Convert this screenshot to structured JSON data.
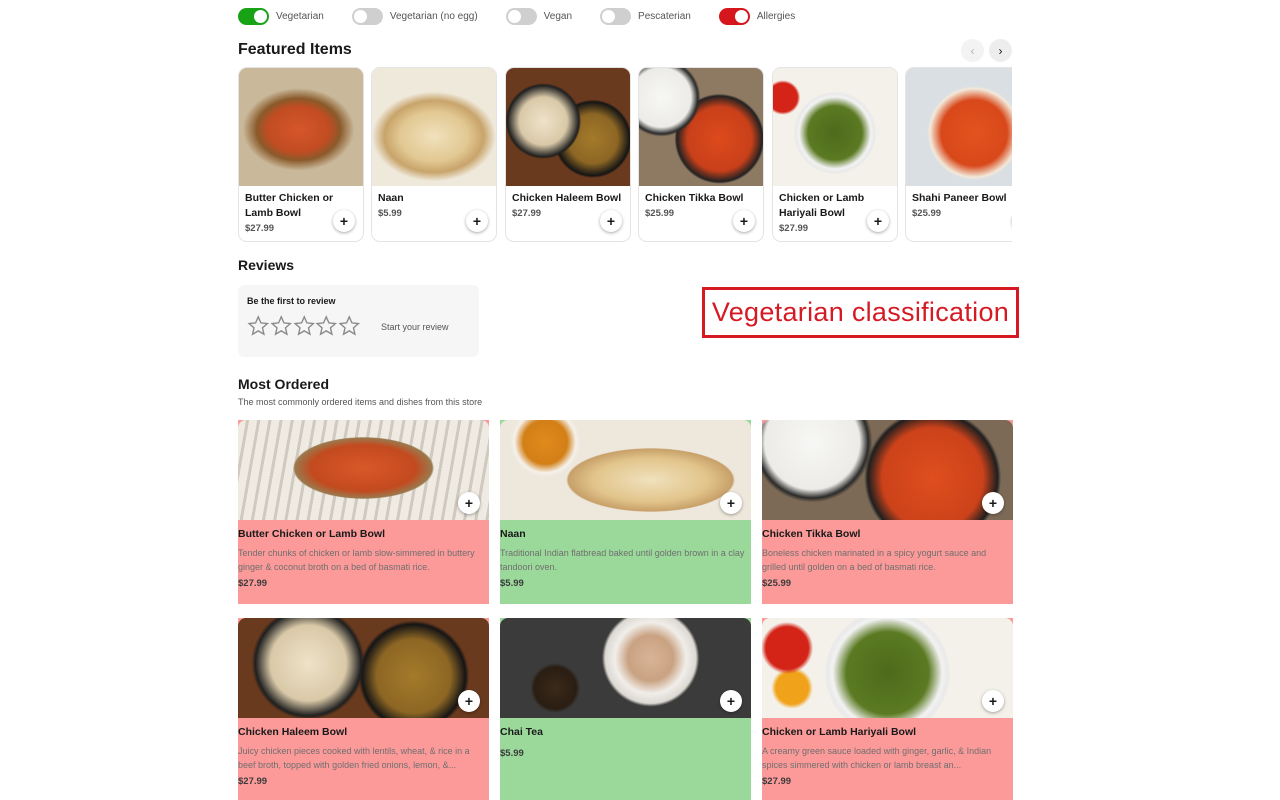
{
  "colors": {
    "toggle_on_green": "#18a317",
    "toggle_on_red": "#d6161d",
    "toggle_off": "#cfcfcf",
    "veg_highlight": "#9bd99b",
    "nonveg_highlight": "#fb9a99",
    "annotation_red": "#d51a24"
  },
  "filters": [
    {
      "label": "Vegetarian",
      "state": "on",
      "color": "#18a317"
    },
    {
      "label": "Vegetarian (no egg)",
      "state": "off"
    },
    {
      "label": "Vegan",
      "state": "off"
    },
    {
      "label": "Pescaterian",
      "state": "off"
    },
    {
      "label": "Allergies",
      "state": "on",
      "color": "#d6161d"
    }
  ],
  "featured": {
    "title": "Featured Items",
    "prev_icon": "chevron-left-icon",
    "next_icon": "chevron-right-icon",
    "items": [
      {
        "name": "Butter Chicken or Lamb Bowl",
        "price": "$27.99"
      },
      {
        "name": "Naan",
        "price": "$5.99"
      },
      {
        "name": "Chicken Haleem Bowl",
        "price": "$27.99"
      },
      {
        "name": "Chicken Tikka Bowl",
        "price": "$25.99"
      },
      {
        "name": "Chicken or Lamb Hariyali Bowl",
        "price": "$27.99"
      },
      {
        "name": "Shahi Paneer Bowl",
        "price": "$25.99"
      }
    ]
  },
  "reviews": {
    "title": "Reviews",
    "box_title": "Be the first to review",
    "cta": "Start your review",
    "star_count": 5
  },
  "annotation": {
    "text": "Vegetarian classification"
  },
  "most_ordered": {
    "title": "Most Ordered",
    "subtitle": "The most commonly ordered items and dishes from this store",
    "items": [
      {
        "name": "Butter Chicken or Lamb Bowl",
        "desc": "Tender chunks of chicken or lamb slow-simmered in buttery ginger & coconut broth on a bed of basmati rice.",
        "price": "$27.99",
        "vegetarian": false
      },
      {
        "name": "Naan",
        "desc": "Traditional Indian flatbread baked until golden brown in a clay tandoori oven.",
        "price": "$5.99",
        "vegetarian": true
      },
      {
        "name": "Chicken Tikka Bowl",
        "desc": "Boneless chicken marinated in a spicy yogurt sauce and grilled until golden on a bed of basmati rice.",
        "price": "$25.99",
        "vegetarian": false
      },
      {
        "name": "Chicken Haleem Bowl",
        "desc": "Juicy chicken pieces cooked with lentils, wheat, & rice in a beef broth, topped with golden fried onions, lemon, &...",
        "price": "$27.99",
        "vegetarian": false
      },
      {
        "name": "Chai Tea",
        "desc": "",
        "price": "$5.99",
        "vegetarian": true
      },
      {
        "name": "Chicken or Lamb Hariyali Bowl",
        "desc": "A creamy green sauce loaded with ginger, garlic, & Indian spices simmered with chicken or lamb breast an...",
        "price": "$27.99",
        "vegetarian": false
      }
    ]
  }
}
